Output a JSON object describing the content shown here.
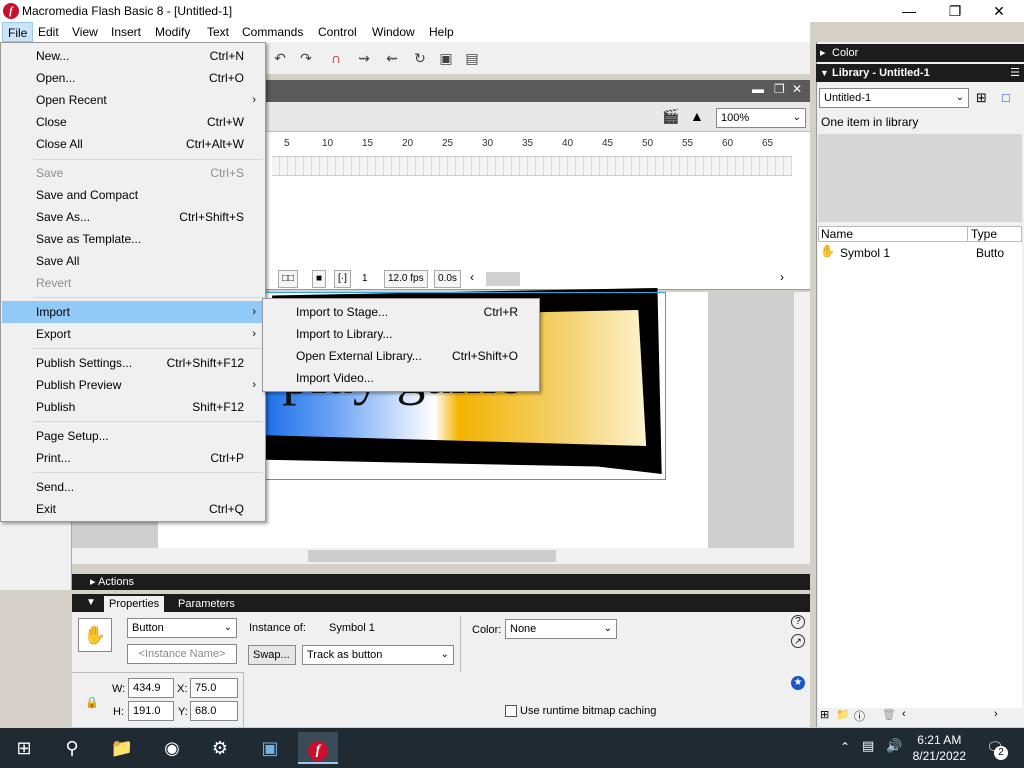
{
  "window": {
    "title": "Macromedia Flash Basic 8 - [Untitled-1]"
  },
  "menubar": [
    "File",
    "Edit",
    "View",
    "Insert",
    "Modify",
    "Text",
    "Commands",
    "Control",
    "Window",
    "Help"
  ],
  "file_menu": [
    {
      "label": "New...",
      "shortcut": "Ctrl+N",
      "disabled": false
    },
    {
      "label": "Open...",
      "shortcut": "Ctrl+O",
      "disabled": false
    },
    {
      "label": "Open Recent",
      "shortcut": "",
      "disabled": false,
      "submenu": true
    },
    {
      "label": "Close",
      "shortcut": "Ctrl+W",
      "disabled": false
    },
    {
      "label": "Close All",
      "shortcut": "Ctrl+Alt+W",
      "disabled": false
    },
    {
      "label": "Save",
      "shortcut": "Ctrl+S",
      "disabled": true
    },
    {
      "label": "Save and Compact",
      "shortcut": "",
      "disabled": false
    },
    {
      "label": "Save As...",
      "shortcut": "Ctrl+Shift+S",
      "disabled": false
    },
    {
      "label": "Save as Template...",
      "shortcut": "",
      "disabled": false
    },
    {
      "label": "Save All",
      "shortcut": "",
      "disabled": false
    },
    {
      "label": "Revert",
      "shortcut": "",
      "disabled": true
    },
    {
      "label": "Import",
      "shortcut": "",
      "disabled": false,
      "submenu": true,
      "highlighted": true
    },
    {
      "label": "Export",
      "shortcut": "",
      "disabled": false,
      "submenu": true
    },
    {
      "label": "Publish Settings...",
      "shortcut": "Ctrl+Shift+F12",
      "disabled": false
    },
    {
      "label": "Publish Preview",
      "shortcut": "",
      "disabled": false,
      "submenu": true
    },
    {
      "label": "Publish",
      "shortcut": "Shift+F12",
      "disabled": false
    },
    {
      "label": "Page Setup...",
      "shortcut": "",
      "disabled": false
    },
    {
      "label": "Print...",
      "shortcut": "Ctrl+P",
      "disabled": false
    },
    {
      "label": "Send...",
      "shortcut": "",
      "disabled": false
    },
    {
      "label": "Exit",
      "shortcut": "Ctrl+Q",
      "disabled": false
    }
  ],
  "import_submenu": [
    {
      "label": "Import to Stage...",
      "shortcut": "Ctrl+R"
    },
    {
      "label": "Import to Library...",
      "shortcut": ""
    },
    {
      "label": "Open External Library...",
      "shortcut": "Ctrl+Shift+O"
    },
    {
      "label": "Import Video...",
      "shortcut": ""
    }
  ],
  "document": {
    "zoom": "100%",
    "ruler": [
      "5",
      "10",
      "15",
      "20",
      "25",
      "30",
      "35",
      "40",
      "45",
      "50",
      "55",
      "60",
      "65"
    ],
    "frame": "1",
    "fps": "12.0 fps",
    "time": "0.0s",
    "stage_text": "play game"
  },
  "panels": {
    "actions": "Actions",
    "properties_tab": "Properties",
    "parameters_tab": "Parameters",
    "color": "Color",
    "library": "Library - Untitled-1"
  },
  "properties": {
    "symbol_type": "Button",
    "instance_name_placeholder": "<Instance Name>",
    "instance_of_label": "Instance of:",
    "instance_of": "Symbol 1",
    "swap": "Swap...",
    "track": "Track as button",
    "color_label": "Color:",
    "color_value": "None",
    "w_label": "W:",
    "w": "434.9",
    "h_label": "H:",
    "h": "191.0",
    "x_label": "X:",
    "x": "75.0",
    "y_label": "Y:",
    "y": "68.0",
    "bitmap_caching": "Use runtime bitmap caching"
  },
  "library": {
    "document": "Untitled-1",
    "count": "One item in library",
    "col_name": "Name",
    "col_type": "Type",
    "items": [
      {
        "name": "Symbol 1",
        "type": "Butto"
      }
    ]
  },
  "taskbar": {
    "time": "6:21 AM",
    "date": "8/21/2022",
    "notifications": "2"
  },
  "colors": {
    "highlight": "#91c9f7",
    "panel_header": "#1c1c1c",
    "taskbar": "#1f2a33"
  }
}
